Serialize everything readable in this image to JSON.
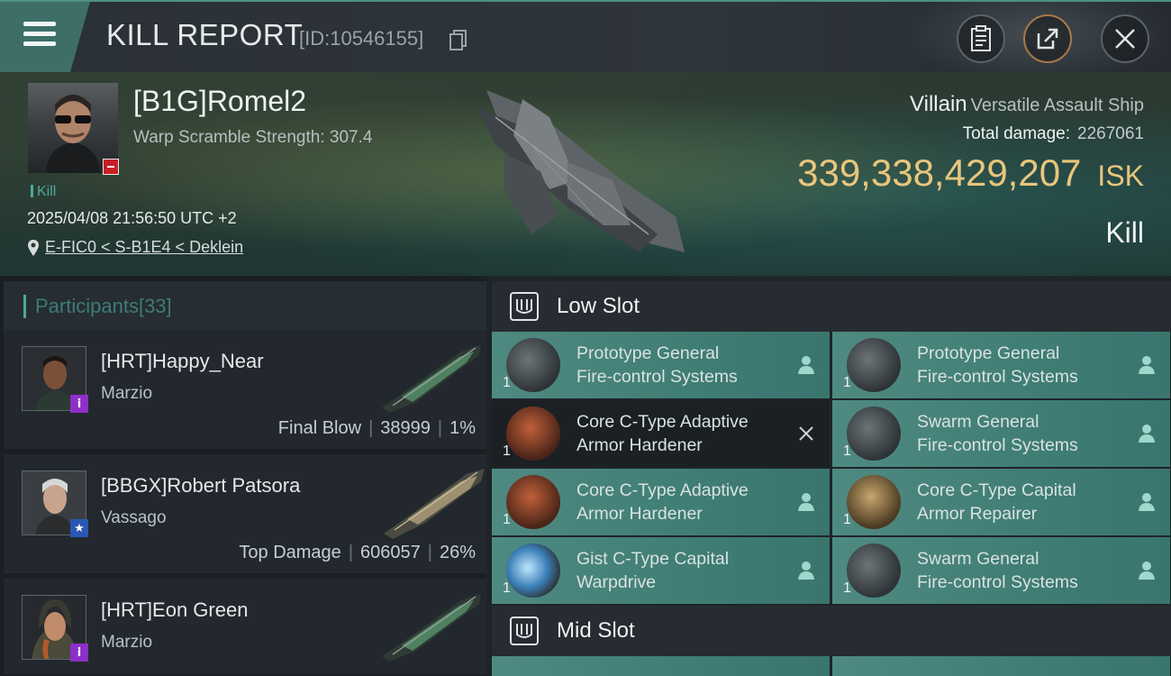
{
  "header": {
    "title": "KILL REPORT",
    "kill_id": "[ID:10546155]"
  },
  "victim": {
    "name": "[B1G]Romel2",
    "warp_line": "Warp Scramble Strength: 307.4",
    "kill_tag": "Kill",
    "timestamp": "2025/04/08 21:56:50 UTC +2",
    "location": "E-FIC0 < S-B1E4 < Deklein",
    "ship_name": "Villain",
    "ship_class": "Versatile Assault Ship",
    "total_damage_label": "Total damage:",
    "total_damage": "2267061",
    "isk_value": "339,338,429,207",
    "isk_unit": "ISK",
    "result": "Kill"
  },
  "participants": {
    "label": "Participants",
    "count": "[33]",
    "rows": [
      {
        "name": "[HRT]Happy_Near",
        "ship": "Marzio",
        "role": "Final Blow",
        "damage": "38999",
        "percent": "1%",
        "badge": "i"
      },
      {
        "name": "[BBGX]Robert Patsora",
        "ship": "Vassago",
        "role": "Top Damage",
        "damage": "606057",
        "percent": "26%",
        "badge": "★"
      },
      {
        "name": "[HRT]Eon Green",
        "ship": "Marzio",
        "badge": "i"
      }
    ]
  },
  "slots": {
    "low_title": "Low Slot",
    "mid_title": "Mid Slot",
    "low_modules": [
      {
        "line1": "Prototype General",
        "line2": "Fire-control Systems",
        "qty": "1",
        "status": "person-icon"
      },
      {
        "line1": "Prototype General",
        "line2": "Fire-control Systems",
        "qty": "1",
        "status": "person-icon"
      },
      {
        "line1": "Core C-Type Adaptive",
        "line2": "Armor Hardener",
        "qty": "1",
        "status": "close-icon"
      },
      {
        "line1": "Swarm General",
        "line2": "Fire-control Systems",
        "qty": "1",
        "status": "person-icon"
      },
      {
        "line1": "Core C-Type Adaptive",
        "line2": "Armor Hardener",
        "qty": "1",
        "status": "person-icon"
      },
      {
        "line1": "Core C-Type Capital",
        "line2": "Armor Repairer",
        "qty": "1",
        "status": "person-icon"
      },
      {
        "line1": "Gist C-Type Capital",
        "line2": "Warpdrive",
        "qty": "1",
        "status": "person-icon"
      },
      {
        "line1": "Swarm General",
        "line2": "Fire-control Systems",
        "qty": "1",
        "status": "person-icon"
      }
    ]
  },
  "colors": {
    "accent_teal": "#4ba89c",
    "isk_gold": "#e8c67c",
    "module_fit": "#3f7d75",
    "minus_badge": "#c62026",
    "badge_purple": "#8d2fc8",
    "badge_blue": "#2a56b4"
  }
}
